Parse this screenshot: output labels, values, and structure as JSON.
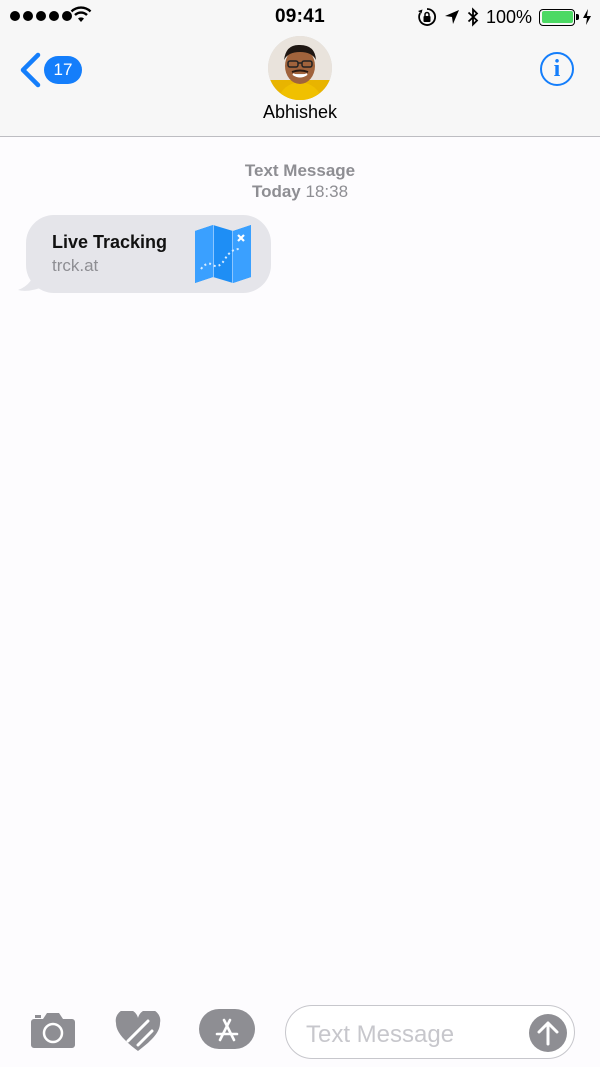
{
  "status_bar": {
    "time": "09:41",
    "battery_percent": "100%",
    "battery_level": 1.0,
    "signal_bars": 5,
    "icons": [
      "signal-dots-icon",
      "wifi-icon",
      "orientation-lock-icon",
      "location-arrow-icon",
      "bluetooth-icon",
      "battery-icon",
      "charging-bolt-icon"
    ]
  },
  "nav": {
    "back_badge": "17",
    "contact_name": "Abhishek",
    "info_icon": "info-icon"
  },
  "conversation": {
    "service_label": "Text Message",
    "day_label": "Today",
    "time_label": "18:38",
    "messages": [
      {
        "title": "Live Tracking",
        "url": "trck.at",
        "thumbnail_icon": "map-icon"
      }
    ]
  },
  "composer": {
    "placeholder": "Text Message",
    "icons": [
      "camera-icon",
      "digital-touch-heart-icon",
      "app-store-icon",
      "send-arrow-icon"
    ]
  },
  "colors": {
    "accent": "#147efb",
    "bubble": "#e5e5ea",
    "muted": "#8e8e93",
    "battery": "#4cd964"
  }
}
